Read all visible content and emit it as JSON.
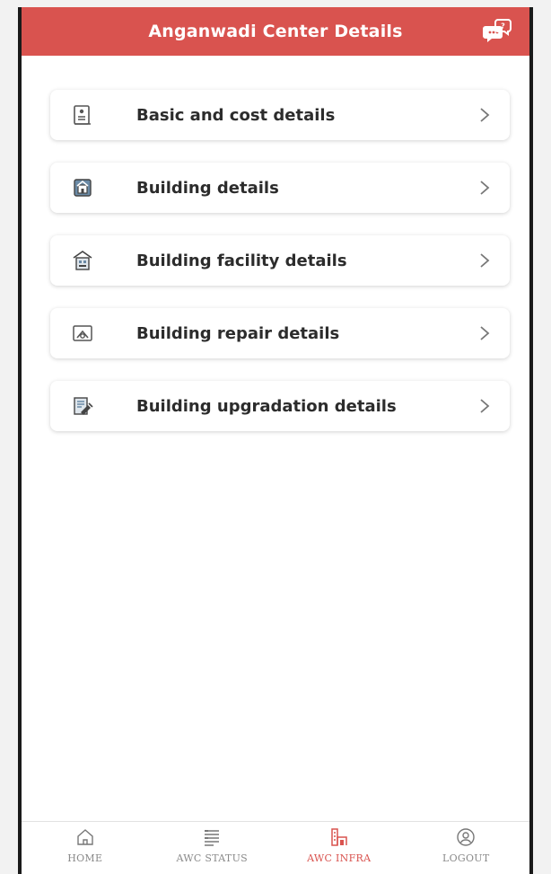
{
  "header": {
    "title": "Anganwadi Center Details",
    "chat_icon": "chat-bubbles-icon"
  },
  "menu": {
    "items": [
      {
        "label": "Basic and cost details",
        "icon": "document-icon"
      },
      {
        "label": "Building details",
        "icon": "building-icon"
      },
      {
        "label": "Building facility details",
        "icon": "facility-icon"
      },
      {
        "label": "Building repair details",
        "icon": "repair-icon"
      },
      {
        "label": "Building upgradation details",
        "icon": "upgrade-icon"
      }
    ]
  },
  "bottom_nav": {
    "items": [
      {
        "label": "HOME",
        "icon": "home-icon",
        "active": false
      },
      {
        "label": "AWC STATUS",
        "icon": "status-list-icon",
        "active": false
      },
      {
        "label": "AWC INFRA",
        "icon": "infra-icon",
        "active": true
      },
      {
        "label": "LOGOUT",
        "icon": "user-icon",
        "active": false
      }
    ]
  },
  "colors": {
    "accent": "#d9534f",
    "text": "#2c2c2c",
    "muted": "#8a8a8a"
  }
}
